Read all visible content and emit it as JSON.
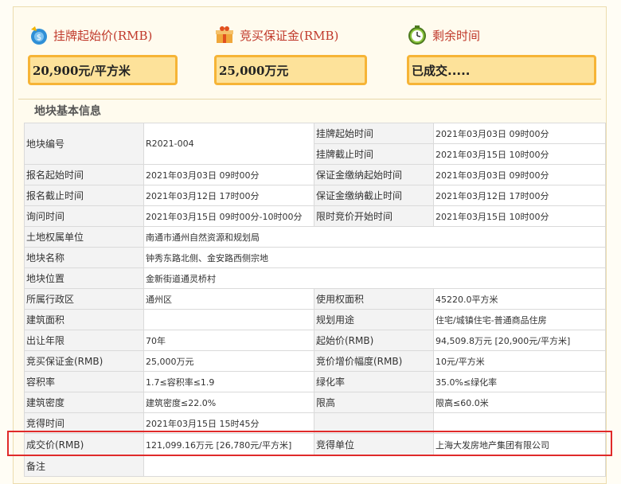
{
  "header": {
    "start_price_label": "挂牌起始价(RMB)",
    "deposit_label": "竞买保证金(RMB)",
    "remaining_time_label": "剩余时间",
    "start_price_value": "20,900元/平方米",
    "deposit_value": "25,000万元",
    "remaining_time_value": "已成交....."
  },
  "section_title": "地块基本信息",
  "rows": {
    "r1": {
      "l1": "地块编号",
      "v1": "R2021-004",
      "l2a": "挂牌起始时间",
      "v2a": "2021年03月03日 09时00分",
      "l2b": "挂牌截止时间",
      "v2b": "2021年03月15日 10时00分"
    },
    "r2": {
      "l1": "报名起始时间",
      "v1": "2021年03月03日 09时00分",
      "l2": "保证金缴纳起始时间",
      "v2": "2021年03月03日 09时00分"
    },
    "r3": {
      "l1": "报名截止时间",
      "v1": "2021年03月12日 17时00分",
      "l2": "保证金缴纳截止时间",
      "v2": "2021年03月12日 17时00分"
    },
    "r4": {
      "l1": "询问时间",
      "v1": "2021年03月15日 09时00分-10时00分",
      "l2": "限时竞价开始时间",
      "v2": "2021年03月15日 10时00分"
    },
    "r5": {
      "l1": "土地权属单位",
      "v1": "南通市通州自然资源和规划局"
    },
    "r6": {
      "l1": "地块名称",
      "v1": "钟秀东路北侧、金安路西侧宗地"
    },
    "r7": {
      "l1": "地块位置",
      "v1": "金新街道通灵桥村"
    },
    "r8": {
      "l1": "所属行政区",
      "v1": "通州区",
      "l2": "使用权面积",
      "v2": "45220.0平方米"
    },
    "r9": {
      "l1": "建筑面积",
      "v1": "",
      "l2": "规划用途",
      "v2": "住宅/城镇住宅-普通商品住房"
    },
    "r10": {
      "l1": "出让年限",
      "v1": "70年",
      "l2": "起始价(RMB)",
      "v2": "94,509.8万元 [20,900元/平方米]"
    },
    "r11": {
      "l1": "竞买保证金(RMB)",
      "v1": "25,000万元",
      "l2": "竞价增价幅度(RMB)",
      "v2": "10元/平方米"
    },
    "r12": {
      "l1": "容积率",
      "v1": "1.7≤容积率≤1.9",
      "l2": "绿化率",
      "v2": "35.0%≤绿化率"
    },
    "r13": {
      "l1": "建筑密度",
      "v1": "建筑密度≤22.0%",
      "l2": "限高",
      "v2": "限高≤60.0米"
    },
    "r14": {
      "l1": "竞得时间",
      "v1": "2021年03月15日 15时45分",
      "l2": "",
      "v2": ""
    },
    "r15": {
      "l1": "成交价(RMB)",
      "v1": "121,099.16万元 [26,780元/平方米]",
      "l2": "竞得单位",
      "v2": "上海大发房地产集团有限公司"
    },
    "r16": {
      "l1": "备注",
      "v1": ""
    }
  },
  "colors": {
    "accent_red": "#c0392b",
    "box_fill": "#fde29a",
    "box_border": "#f6b436",
    "highlight": "#e02a2a"
  },
  "icons": [
    "money-bag-icon",
    "gift-box-icon",
    "clock-icon"
  ]
}
